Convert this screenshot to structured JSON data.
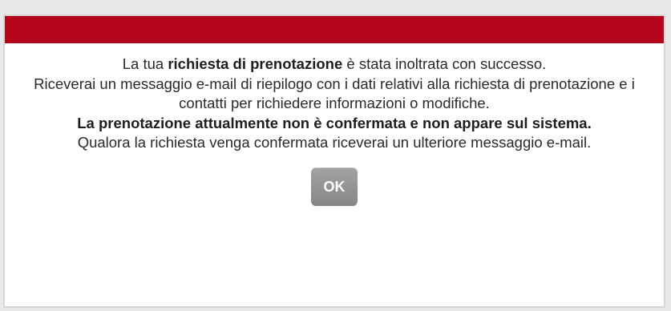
{
  "dialog": {
    "header_color": "#b5071c",
    "line1_pre": "La tua ",
    "line1_bold": "richiesta di prenotazione",
    "line1_post": " è stata inoltrata con successo.",
    "line2": "Riceverai un messaggio e-mail di riepilogo con i dati relativi alla richiesta di prenotazione e i contatti per richiedere informazioni o modifiche.",
    "warning_bold": "La prenotazione attualmente non è confermata e non appare sul sistema.",
    "line4": "Qualora la richiesta venga confermata riceverai un ulteriore messaggio e-mail.",
    "ok_label": "OK"
  }
}
